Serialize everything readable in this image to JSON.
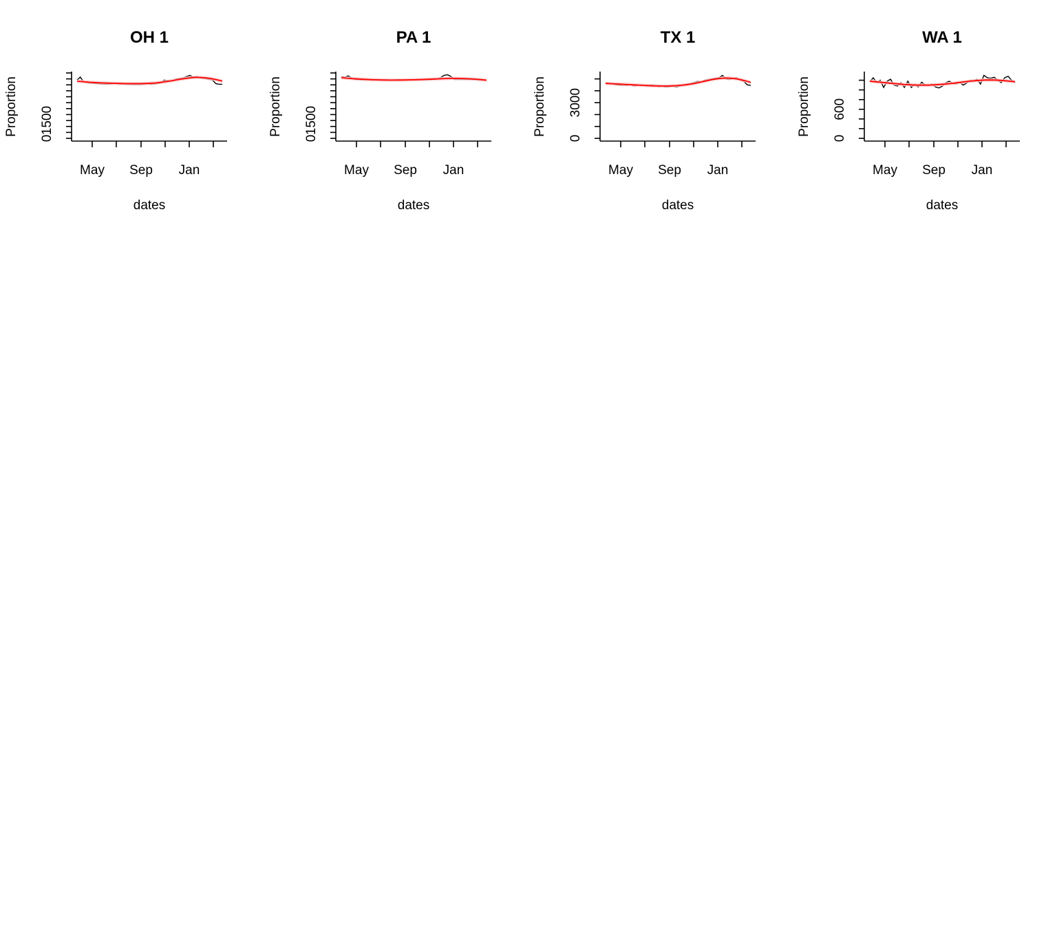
{
  "chart_data": [
    {
      "type": "line",
      "title": "OH 1",
      "xlabel": "dates",
      "ylabel": "Proportion",
      "x_tick_labels": [
        "May",
        "Sep",
        "Jan"
      ],
      "y_tick_labels": [
        "0",
        "1500"
      ],
      "ylim": [
        0,
        5500
      ],
      "x": [
        "2020-03-15",
        "2020-03-22",
        "2020-03-29",
        "2020-04-05",
        "2020-04-12",
        "2020-04-19",
        "2020-04-26",
        "2020-05-03",
        "2020-05-10",
        "2020-05-17",
        "2020-05-24",
        "2020-05-31",
        "2020-06-07",
        "2020-06-14",
        "2020-06-21",
        "2020-06-28",
        "2020-07-05",
        "2020-07-12",
        "2020-07-19",
        "2020-07-26",
        "2020-08-02",
        "2020-08-09",
        "2020-08-16",
        "2020-08-23",
        "2020-08-30",
        "2020-09-06",
        "2020-09-13",
        "2020-09-20",
        "2020-09-27",
        "2020-10-04",
        "2020-10-11",
        "2020-10-18",
        "2020-10-25",
        "2020-11-01",
        "2020-11-08",
        "2020-11-15",
        "2020-11-22",
        "2020-11-29",
        "2020-12-06",
        "2020-12-13",
        "2020-12-20",
        "2020-12-27",
        "2021-01-03",
        "2021-01-10",
        "2021-01-17",
        "2021-01-24",
        "2021-01-31",
        "2021-02-07",
        "2021-02-14",
        "2021-02-21",
        "2021-02-28",
        "2021-03-07",
        "2021-03-14",
        "2021-03-21"
      ],
      "series": [
        {
          "color": "#000000",
          "values": [
            4900,
            5150,
            4750,
            4700,
            4650,
            4620,
            4600,
            4580,
            4560,
            4550,
            4560,
            4600,
            4620,
            4580,
            4570,
            4560,
            4540,
            4530,
            4520,
            4530,
            4520,
            4560,
            4600,
            4540,
            4560,
            4620,
            4680,
            4900,
            4850,
            4820,
            4900,
            5000,
            5050,
            5100,
            5200,
            5300,
            5150,
            5200,
            5100,
            5050,
            5000,
            4950,
            4900,
            4600,
            4550,
            4550
          ]
        },
        {
          "color": "#ff0000",
          "values": [
            4800,
            4780,
            4750,
            4720,
            4700,
            4680,
            4660,
            4650,
            4640,
            4630,
            4620,
            4610,
            4600,
            4600,
            4600,
            4600,
            4610,
            4620,
            4640,
            4660,
            4700,
            4750,
            4800,
            4860,
            4920,
            4980,
            5030,
            5080,
            5120,
            5130,
            5120,
            5090,
            5040,
            4980,
            4900,
            4820
          ]
        }
      ]
    },
    {
      "type": "line",
      "title": "PA 1",
      "xlabel": "dates",
      "ylabel": "Proportion",
      "x_tick_labels": [
        "May",
        "Sep",
        "Jan"
      ],
      "y_tick_labels": [
        "0",
        "1500"
      ],
      "ylim": [
        0,
        5500
      ],
      "series": [
        {
          "color": "#000000",
          "values": [
            5200,
            5150,
            5250,
            5050,
            4950,
            4950,
            4920,
            4950,
            4930,
            4920,
            4950,
            4900,
            4920,
            4930,
            4900,
            4920,
            4940,
            4930,
            4900,
            4920,
            4940,
            4930,
            4950,
            4920,
            4950,
            4950,
            4960,
            4980,
            5100,
            5300,
            5350,
            5200,
            4950,
            4950,
            4950,
            4950,
            4960,
            4950,
            4950,
            4940,
            4900,
            4900
          ]
        },
        {
          "color": "#ff0000",
          "values": [
            5100,
            5060,
            5020,
            4990,
            4960,
            4940,
            4920,
            4910,
            4900,
            4900,
            4900,
            4910,
            4920,
            4930,
            4950,
            4970,
            4990,
            5010,
            5030,
            5040,
            5040,
            5030,
            5010,
            4980,
            4940,
            4890
          ]
        }
      ]
    },
    {
      "type": "line",
      "title": "TX 1",
      "xlabel": "dates",
      "ylabel": "Proportion",
      "x_tick_labels": [
        "May",
        "Sep",
        "Jan"
      ],
      "y_tick_labels": [
        "0",
        "3000"
      ],
      "ylim": [
        0,
        5500
      ],
      "series": [
        {
          "color": "#000000",
          "values": [
            4650,
            4620,
            4600,
            4500,
            4450,
            4480,
            4450,
            4520,
            4400,
            4450,
            4500,
            4450,
            4400,
            4500,
            4450,
            4350,
            4400,
            4300,
            4350,
            4400,
            4300,
            4400,
            4500,
            4550,
            4600,
            4700,
            4800,
            4750,
            4900,
            4950,
            5000,
            5050,
            5100,
            5300,
            5000,
            4950,
            5050,
            5100,
            4900,
            4800,
            4500,
            4450
          ]
        },
        {
          "color": "#ff0000",
          "values": [
            4620,
            4600,
            4580,
            4560,
            4540,
            4520,
            4500,
            4480,
            4460,
            4440,
            4420,
            4410,
            4400,
            4400,
            4410,
            4430,
            4460,
            4500,
            4550,
            4620,
            4700,
            4790,
            4880,
            4960,
            5020,
            5060,
            5070,
            5050,
            5000,
            4920,
            4820,
            4700
          ]
        }
      ]
    },
    {
      "type": "line",
      "title": "WA 1",
      "xlabel": "dates",
      "ylabel": "Proportion",
      "x_tick_labels": [
        "May",
        "Sep",
        "Jan"
      ],
      "y_tick_labels": [
        "0",
        "600"
      ],
      "ylim": [
        0,
        1350
      ],
      "series": [
        {
          "color": "#000000",
          "values": [
            1170,
            1250,
            1150,
            1200,
            1050,
            1180,
            1220,
            1100,
            1080,
            1150,
            1050,
            1180,
            1050,
            1120,
            1060,
            1160,
            1100,
            1090,
            1120,
            1060,
            1040,
            1080,
            1150,
            1180,
            1130,
            1120,
            1160,
            1100,
            1140,
            1200,
            1180,
            1220,
            1120,
            1300,
            1250,
            1240,
            1260,
            1200,
            1150,
            1250,
            1280,
            1200,
            1150
          ]
        },
        {
          "color": "#ff0000",
          "values": [
            1180,
            1170,
            1160,
            1150,
            1140,
            1130,
            1120,
            1110,
            1105,
            1100,
            1098,
            1098,
            1100,
            1105,
            1112,
            1120,
            1130,
            1142,
            1155,
            1168,
            1180,
            1190,
            1198,
            1203,
            1205,
            1203,
            1198,
            1190,
            1180,
            1168
          ]
        }
      ]
    }
  ]
}
